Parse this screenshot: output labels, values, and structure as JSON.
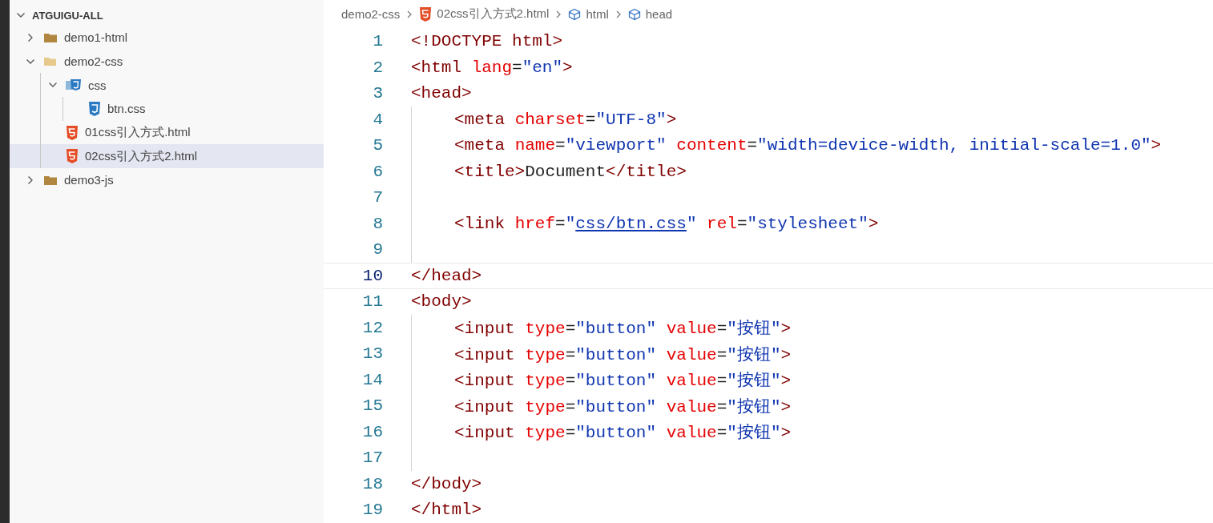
{
  "explorer": {
    "title": "ATGUIGU-ALL",
    "expanded": true,
    "items": [
      {
        "kind": "folder",
        "label": "demo1-html",
        "expanded": false,
        "selected": false
      },
      {
        "kind": "folder",
        "label": "demo2-css",
        "expanded": true,
        "selected": false,
        "children": [
          {
            "kind": "css-folder",
            "label": "css",
            "expanded": true,
            "selected": false,
            "children": [
              {
                "kind": "css-file",
                "label": "btn.css",
                "selected": false
              }
            ]
          },
          {
            "kind": "html-file",
            "label": "01css引入方式.html",
            "selected": false
          },
          {
            "kind": "html-file",
            "label": "02css引入方式2.html",
            "selected": true
          }
        ]
      },
      {
        "kind": "folder",
        "label": "demo3-js",
        "expanded": false,
        "selected": false
      }
    ]
  },
  "breadcrumbs": [
    {
      "kind": "folder",
      "label": "demo2-css"
    },
    {
      "kind": "html-file",
      "label": "02css引入方式2.html"
    },
    {
      "kind": "element",
      "label": "html"
    },
    {
      "kind": "element",
      "label": "head"
    }
  ],
  "lines": [
    {
      "number": "1",
      "current": false,
      "indent_guide": false,
      "tokens": [
        {
          "kind": "tag",
          "text": "<!DOCTYPE "
        },
        {
          "kind": "tag",
          "text": "html"
        },
        {
          "kind": "tag",
          "text": ">"
        }
      ]
    },
    {
      "number": "2",
      "current": false,
      "indent_guide": false,
      "tokens": [
        {
          "kind": "tag",
          "text": "<html "
        },
        {
          "kind": "attr",
          "text": "lang"
        },
        {
          "kind": "plain",
          "text": "="
        },
        {
          "kind": "string",
          "text": "\"en\""
        },
        {
          "kind": "tag",
          "text": ">"
        }
      ]
    },
    {
      "number": "3",
      "current": false,
      "indent_guide": false,
      "tokens": [
        {
          "kind": "tag",
          "text": "<head>"
        }
      ]
    },
    {
      "number": "4",
      "current": false,
      "indent_guide": true,
      "tokens": [
        {
          "kind": "tag",
          "text": "<meta "
        },
        {
          "kind": "attr",
          "text": "charset"
        },
        {
          "kind": "plain",
          "text": "="
        },
        {
          "kind": "string",
          "text": "\"UTF-8\""
        },
        {
          "kind": "tag",
          "text": ">"
        }
      ]
    },
    {
      "number": "5",
      "current": false,
      "indent_guide": true,
      "tokens": [
        {
          "kind": "tag",
          "text": "<meta "
        },
        {
          "kind": "attr",
          "text": "name"
        },
        {
          "kind": "plain",
          "text": "="
        },
        {
          "kind": "string",
          "text": "\"viewport\" "
        },
        {
          "kind": "attr",
          "text": "content"
        },
        {
          "kind": "plain",
          "text": "="
        },
        {
          "kind": "string",
          "text": "\"width=device-width, initial-scale=1.0\""
        },
        {
          "kind": "tag",
          "text": ">"
        }
      ]
    },
    {
      "number": "6",
      "current": false,
      "indent_guide": true,
      "tokens": [
        {
          "kind": "tag",
          "text": "<title>"
        },
        {
          "kind": "plain",
          "text": "Document"
        },
        {
          "kind": "tag",
          "text": "</title>"
        }
      ]
    },
    {
      "number": "7",
      "current": false,
      "indent_guide": true
    },
    {
      "number": "8",
      "current": false,
      "indent_guide": true,
      "tokens": [
        {
          "kind": "tag",
          "text": "<link "
        },
        {
          "kind": "attr",
          "text": "href"
        },
        {
          "kind": "plain",
          "text": "="
        },
        {
          "kind": "string",
          "text": "\""
        },
        {
          "kind": "link",
          "text": "css/btn.css"
        },
        {
          "kind": "string",
          "text": "\" "
        },
        {
          "kind": "attr",
          "text": "rel"
        },
        {
          "kind": "plain",
          "text": "="
        },
        {
          "kind": "string",
          "text": "\"stylesheet\""
        },
        {
          "kind": "tag",
          "text": ">"
        }
      ]
    },
    {
      "number": "9",
      "current": false,
      "indent_guide": true
    },
    {
      "number": "10",
      "current": true,
      "indent_guide": false,
      "tokens": [
        {
          "kind": "tag",
          "text": "</head>"
        }
      ]
    },
    {
      "number": "11",
      "current": false,
      "indent_guide": false,
      "tokens": [
        {
          "kind": "tag",
          "text": "<body>"
        }
      ]
    },
    {
      "number": "12",
      "current": false,
      "indent_guide": true,
      "tokens": [
        {
          "kind": "tag",
          "text": "<input "
        },
        {
          "kind": "attr",
          "text": "type"
        },
        {
          "kind": "plain",
          "text": "="
        },
        {
          "kind": "string",
          "text": "\"button\" "
        },
        {
          "kind": "attr",
          "text": "value"
        },
        {
          "kind": "plain",
          "text": "="
        },
        {
          "kind": "string",
          "text": "\"按钮\""
        },
        {
          "kind": "tag",
          "text": ">"
        }
      ]
    },
    {
      "number": "13",
      "current": false,
      "indent_guide": true,
      "tokens": [
        {
          "kind": "tag",
          "text": "<input "
        },
        {
          "kind": "attr",
          "text": "type"
        },
        {
          "kind": "plain",
          "text": "="
        },
        {
          "kind": "string",
          "text": "\"button\" "
        },
        {
          "kind": "attr",
          "text": "value"
        },
        {
          "kind": "plain",
          "text": "="
        },
        {
          "kind": "string",
          "text": "\"按钮\""
        },
        {
          "kind": "tag",
          "text": ">"
        }
      ]
    },
    {
      "number": "14",
      "current": false,
      "indent_guide": true,
      "tokens": [
        {
          "kind": "tag",
          "text": "<input "
        },
        {
          "kind": "attr",
          "text": "type"
        },
        {
          "kind": "plain",
          "text": "="
        },
        {
          "kind": "string",
          "text": "\"button\" "
        },
        {
          "kind": "attr",
          "text": "value"
        },
        {
          "kind": "plain",
          "text": "="
        },
        {
          "kind": "string",
          "text": "\"按钮\""
        },
        {
          "kind": "tag",
          "text": ">"
        }
      ]
    },
    {
      "number": "15",
      "current": false,
      "indent_guide": true,
      "tokens": [
        {
          "kind": "tag",
          "text": "<input "
        },
        {
          "kind": "attr",
          "text": "type"
        },
        {
          "kind": "plain",
          "text": "="
        },
        {
          "kind": "string",
          "text": "\"button\" "
        },
        {
          "kind": "attr",
          "text": "value"
        },
        {
          "kind": "plain",
          "text": "="
        },
        {
          "kind": "string",
          "text": "\"按钮\""
        },
        {
          "kind": "tag",
          "text": ">"
        }
      ]
    },
    {
      "number": "16",
      "current": false,
      "indent_guide": true,
      "tokens": [
        {
          "kind": "tag",
          "text": "<input "
        },
        {
          "kind": "attr",
          "text": "type"
        },
        {
          "kind": "plain",
          "text": "="
        },
        {
          "kind": "string",
          "text": "\"button\" "
        },
        {
          "kind": "attr",
          "text": "value"
        },
        {
          "kind": "plain",
          "text": "="
        },
        {
          "kind": "string",
          "text": "\"按钮\""
        },
        {
          "kind": "tag",
          "text": ">"
        }
      ]
    },
    {
      "number": "17",
      "current": false,
      "indent_guide": true
    },
    {
      "number": "18",
      "current": false,
      "indent_guide": false,
      "tokens": [
        {
          "kind": "tag",
          "text": "</body>"
        }
      ]
    },
    {
      "number": "19",
      "current": false,
      "indent_guide": false,
      "tokens": [
        {
          "kind": "tag",
          "text": "</html>"
        }
      ]
    }
  ]
}
